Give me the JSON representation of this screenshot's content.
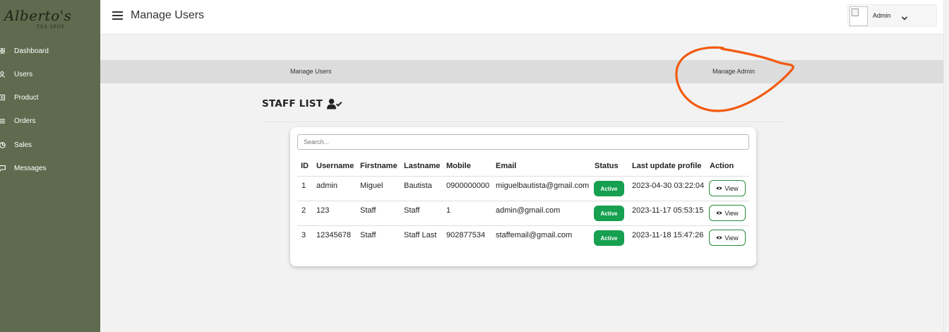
{
  "brand": {
    "name": "Alberto's",
    "tagline": "TEA SPOT"
  },
  "sidebar": {
    "items": [
      {
        "label": "Dashboard",
        "icon": "dashboard-grid-icon"
      },
      {
        "label": "Users",
        "icon": "user-icon"
      },
      {
        "label": "Product",
        "icon": "product-icon"
      },
      {
        "label": "Orders",
        "icon": "list-icon"
      },
      {
        "label": "Sales",
        "icon": "chart-pie-icon"
      },
      {
        "label": "Messages",
        "icon": "message-icon"
      }
    ]
  },
  "header": {
    "title": "Manage Users",
    "user_name": "Admin"
  },
  "tabs": [
    {
      "label": "Manage Users"
    },
    {
      "label": "Manage Admin"
    }
  ],
  "staff_list": {
    "title": "STAFF LIST",
    "search_placeholder": "Search...",
    "columns": [
      "ID",
      "Username",
      "Firstname",
      "Lastname",
      "Mobile",
      "Email",
      "Status",
      "Last update profile",
      "Action"
    ],
    "rows": [
      {
        "id": "1",
        "username": "admin",
        "firstname": "Miguel",
        "lastname": "Bautista",
        "mobile": "0900000000",
        "email": "miguelbautista@gmail.com",
        "status": "Active",
        "updated": "2023-04-30 03:22:04",
        "action": "View"
      },
      {
        "id": "2",
        "username": "123",
        "firstname": "Staff",
        "lastname": "Staff",
        "mobile": "1",
        "email": "admin@gmail.com",
        "status": "Active",
        "updated": "2023-11-17 05:53:15",
        "action": "View"
      },
      {
        "id": "3",
        "username": "12345678",
        "firstname": "Staff",
        "lastname": "Staff Last",
        "mobile": "902877534",
        "email": "staffemail@gmail.com",
        "status": "Active",
        "updated": "2023-11-18 15:47:26",
        "action": "View"
      }
    ]
  },
  "colors": {
    "sidebar": "#5e6b4e",
    "status_active": "#16a050",
    "annotation": "#f25a10",
    "tabs_band": "#dcdcdc"
  }
}
